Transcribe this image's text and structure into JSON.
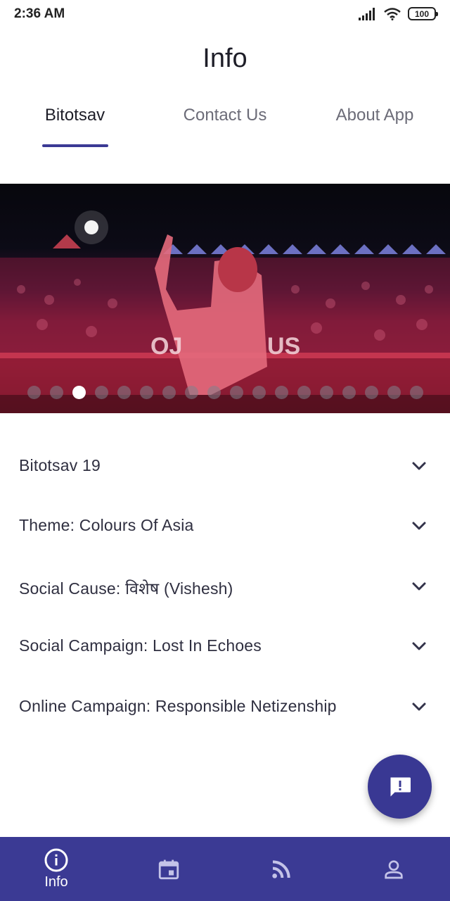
{
  "status_bar": {
    "time": "2:36 AM",
    "battery": "100"
  },
  "header": {
    "title": "Info"
  },
  "tabs": [
    {
      "label": "Bitotsav",
      "active": true
    },
    {
      "label": "Contact Us",
      "active": false
    },
    {
      "label": "About App",
      "active": false
    }
  ],
  "carousel": {
    "slide_count": 18,
    "active_index": 2
  },
  "accordion": [
    {
      "label": "Bitotsav 19"
    },
    {
      "label": "Theme: Colours Of Asia"
    },
    {
      "label": "Social Cause: विशेष (Vishesh)"
    },
    {
      "label": "Social Campaign: Lost In Echoes"
    },
    {
      "label": "Online Campaign: Responsible Netizenship"
    }
  ],
  "fab": {
    "icon": "feedback-icon"
  },
  "bottom_nav": [
    {
      "icon": "info-icon",
      "label": "Info",
      "active": true
    },
    {
      "icon": "calendar-icon",
      "label": "",
      "active": false
    },
    {
      "icon": "rss-feed-icon",
      "label": "",
      "active": false
    },
    {
      "icon": "person-icon",
      "label": "",
      "active": false
    }
  ],
  "colors": {
    "primary": "#3b3a94",
    "text": "#2f2f40",
    "inactive_tab": "#6c6c78"
  }
}
